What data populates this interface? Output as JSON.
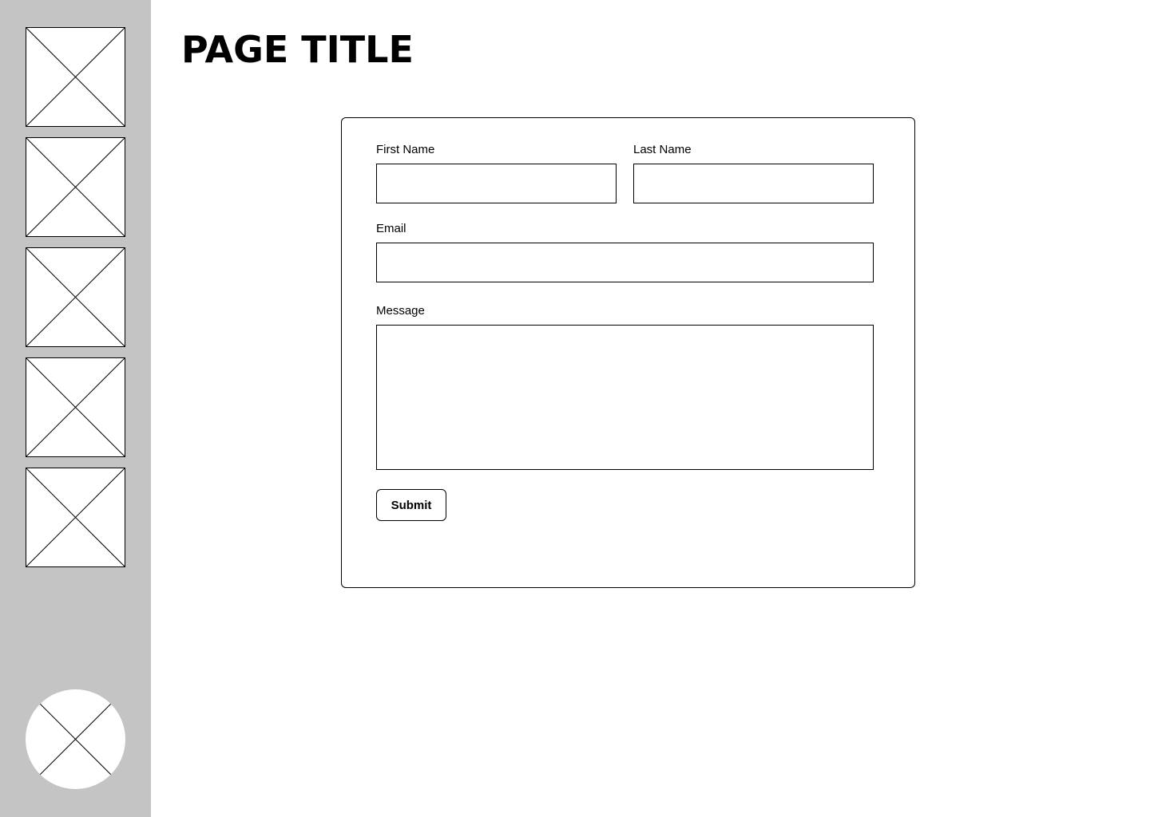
{
  "page_title": "PAGE TITLE",
  "sidebar": {
    "background": "#c4c4c4",
    "items": [
      {
        "icon": "image-placeholder-icon"
      },
      {
        "icon": "image-placeholder-icon"
      },
      {
        "icon": "image-placeholder-icon"
      },
      {
        "icon": "image-placeholder-icon"
      },
      {
        "icon": "image-placeholder-icon"
      }
    ],
    "avatar": {
      "icon": "avatar-placeholder-icon"
    }
  },
  "form": {
    "first_name_label": "First Name",
    "first_name_value": "",
    "last_name_label": "Last Name",
    "last_name_value": "",
    "email_label": "Email",
    "email_value": "",
    "message_label": "Message",
    "message_value": "",
    "submit_label": "Submit"
  }
}
